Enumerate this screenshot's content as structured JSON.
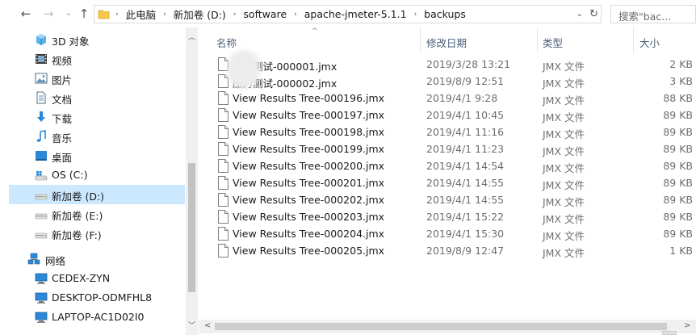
{
  "nav_buttons": {
    "back_icon": "arrow-left-icon",
    "forward_icon": "arrow-right-icon",
    "recent_icon": "chevron-down-icon",
    "up_icon": "arrow-up-icon",
    "back_glyph": "←",
    "forward_glyph": "→",
    "recent_glyph": "⌄",
    "up_glyph": "↑"
  },
  "address": {
    "separator": "›",
    "crumbs": [
      "此电脑",
      "新加卷 (D:)",
      "software",
      "apache-jmeter-5.1.1",
      "backups"
    ],
    "dropdown_glyph": "⌄",
    "refresh_glyph": "↻"
  },
  "search": {
    "placeholder": "搜索\"bac..."
  },
  "sidebar": {
    "items": [
      {
        "label": "3D 对象",
        "icon": "3d-objects-icon"
      },
      {
        "label": "视频",
        "icon": "video-icon"
      },
      {
        "label": "图片",
        "icon": "pictures-icon"
      },
      {
        "label": "文档",
        "icon": "documents-icon"
      },
      {
        "label": "下载",
        "icon": "download-icon"
      },
      {
        "label": "音乐",
        "icon": "music-icon"
      },
      {
        "label": "桌面",
        "icon": "desktop-icon"
      },
      {
        "label": "OS (C:)",
        "icon": "windows-drive-icon"
      },
      {
        "label": "新加卷 (D:)",
        "icon": "drive-icon",
        "selected": true
      },
      {
        "label": "新加卷 (E:)",
        "icon": "drive-icon"
      },
      {
        "label": "新加卷 (F:)",
        "icon": "drive-icon"
      }
    ],
    "network": {
      "label": "网络",
      "icon": "network-icon"
    },
    "computers": [
      {
        "label": "CEDEX-ZYN",
        "icon": "computer-icon"
      },
      {
        "label": "DESKTOP-ODMFHL8",
        "icon": "computer-icon"
      },
      {
        "label": "LAPTOP-AC1D02I0",
        "icon": "computer-icon"
      }
    ]
  },
  "columns": {
    "name": "名称",
    "date": "修改日期",
    "type": "类型",
    "size": "大小",
    "sort_glyph": "^"
  },
  "files": [
    {
      "name": "压力测试-000001.jmx",
      "date": "2019/3/28 13:21",
      "type": "JMX 文件",
      "size": "2 KB"
    },
    {
      "name": "压力测试-000002.jmx",
      "date": "2019/8/9 12:51",
      "type": "JMX 文件",
      "size": "3 KB"
    },
    {
      "name": "View Results Tree-000196.jmx",
      "date": "2019/4/1 9:28",
      "type": "JMX 文件",
      "size": "88 KB"
    },
    {
      "name": "View Results Tree-000197.jmx",
      "date": "2019/4/1 10:45",
      "type": "JMX 文件",
      "size": "89 KB"
    },
    {
      "name": "View Results Tree-000198.jmx",
      "date": "2019/4/1 11:16",
      "type": "JMX 文件",
      "size": "89 KB"
    },
    {
      "name": "View Results Tree-000199.jmx",
      "date": "2019/4/1 11:23",
      "type": "JMX 文件",
      "size": "89 KB"
    },
    {
      "name": "View Results Tree-000200.jmx",
      "date": "2019/4/1 14:54",
      "type": "JMX 文件",
      "size": "89 KB"
    },
    {
      "name": "View Results Tree-000201.jmx",
      "date": "2019/4/1 14:55",
      "type": "JMX 文件",
      "size": "89 KB"
    },
    {
      "name": "View Results Tree-000202.jmx",
      "date": "2019/4/1 14:55",
      "type": "JMX 文件",
      "size": "89 KB"
    },
    {
      "name": "View Results Tree-000203.jmx",
      "date": "2019/4/1 15:22",
      "type": "JMX 文件",
      "size": "89 KB"
    },
    {
      "name": "View Results Tree-000204.jmx",
      "date": "2019/4/1 15:30",
      "type": "JMX 文件",
      "size": "89 KB"
    },
    {
      "name": "View Results Tree-000205.jmx",
      "date": "2019/8/9 12:47",
      "type": "JMX 文件",
      "size": "1 KB"
    }
  ],
  "scrollbars": {
    "up_glyph": "︿",
    "down_glyph": "﹀",
    "left_glyph": "<",
    "right_glyph": ">"
  },
  "colors": {
    "selection": "#cce8ff",
    "header_text": "#4c607a",
    "folder": "#f5c84c",
    "accent_blue": "#2b88d8"
  }
}
